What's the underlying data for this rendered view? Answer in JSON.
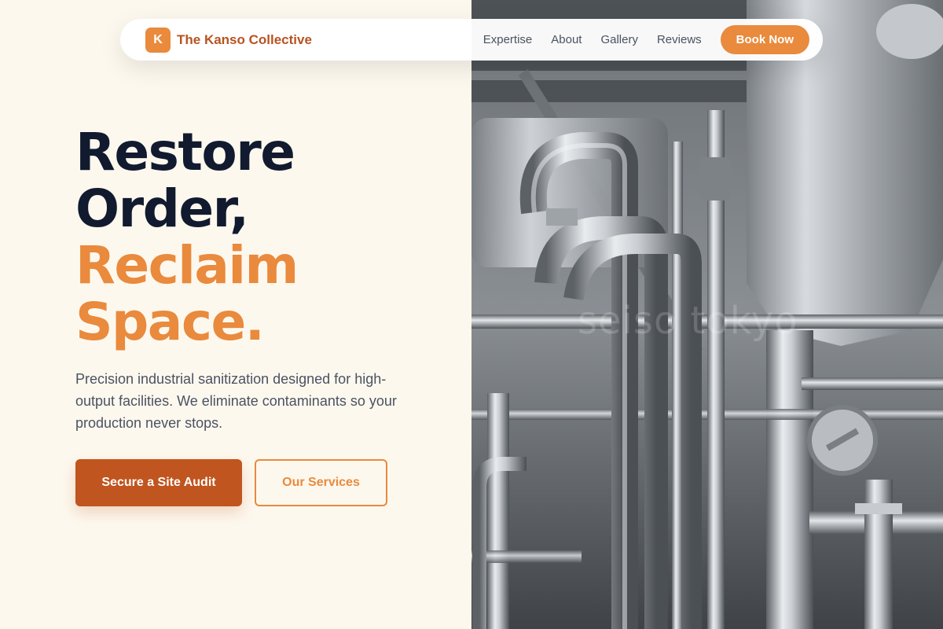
{
  "brand": {
    "badge_letter": "K",
    "name": "The Kanso Collective"
  },
  "nav": {
    "links": [
      {
        "label": "Expertise"
      },
      {
        "label": "About"
      },
      {
        "label": "Gallery"
      },
      {
        "label": "Reviews"
      }
    ],
    "cta_label": "Book Now"
  },
  "hero": {
    "headline_line1": "Restore",
    "headline_line2": "Order,",
    "headline_line3": "Reclaim",
    "headline_line4": "Space.",
    "subtitle": "Precision industrial sanitization designed for high-output facilities. We eliminate contaminants so your production never stops.",
    "primary_cta": "Secure a Site Audit",
    "secondary_cta": "Our Services",
    "watermark": "seiso tokyo"
  },
  "colors": {
    "background": "#fdf8ee",
    "accent": "#e98a3d",
    "brand_text": "#b8531f",
    "primary_button": "#c0551f",
    "headline_dark": "#111a2e",
    "body_text": "#4a5262"
  },
  "icons": {
    "brand_badge": "letter-k-badge"
  }
}
